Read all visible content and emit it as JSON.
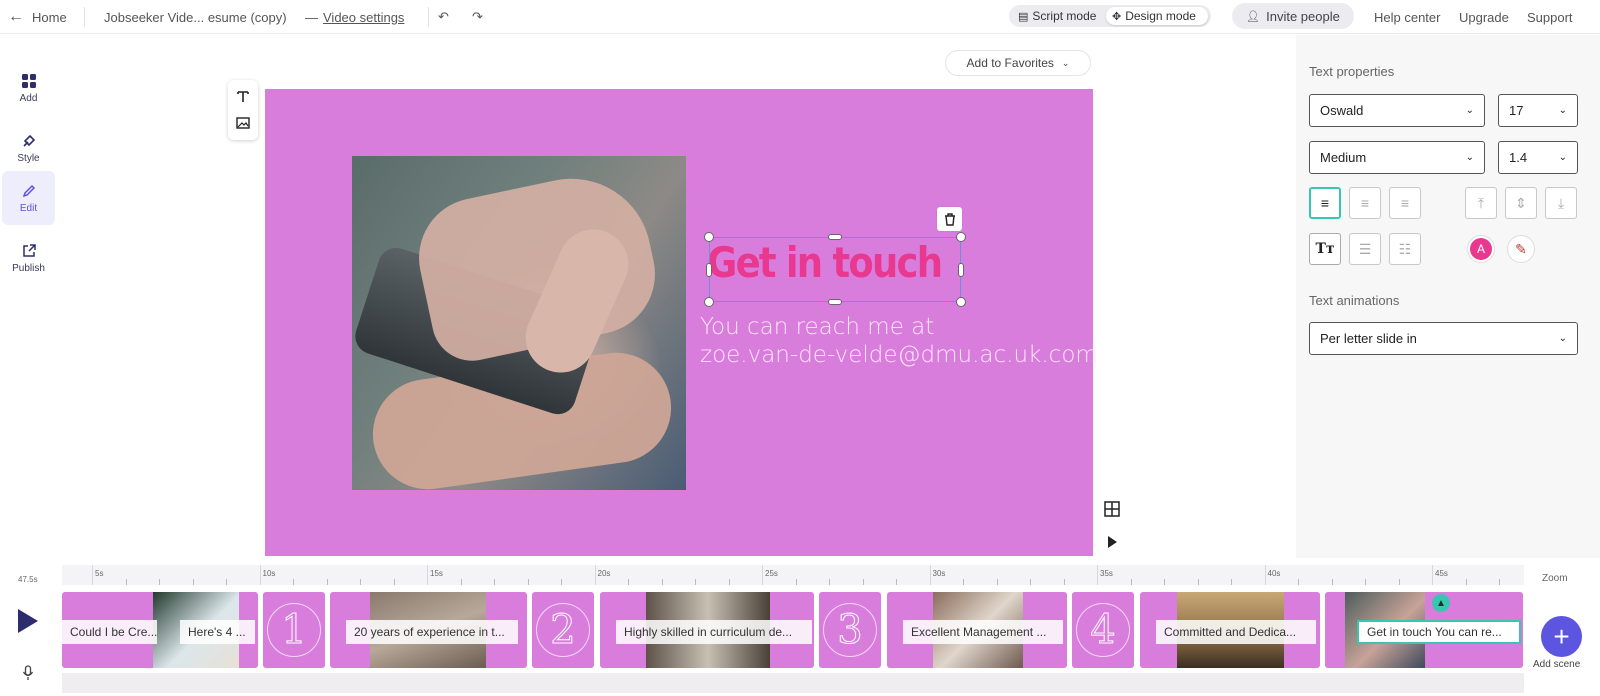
{
  "topbar": {
    "home_label": "Home",
    "project_title": "Jobseeker Vide... esume  (copy)",
    "dash": "—",
    "video_settings": "Video settings",
    "script_mode": "Script mode",
    "design_mode": "Design mode",
    "invite": "Invite people",
    "help": "Help center",
    "upgrade": "Upgrade",
    "support": "Support"
  },
  "rail": {
    "add": "Add",
    "style": "Style",
    "edit": "Edit",
    "publish": "Publish"
  },
  "canvas": {
    "favorites": "Add to Favorites",
    "headline": "Get in touch",
    "body_line1": "You can reach me at",
    "body_line2": "zoe.van-de-velde@dmu.ac.uk.com",
    "background_color": "#d97ddd",
    "headline_color": "#e8388f"
  },
  "panel": {
    "text_properties": "Text properties",
    "font": "Oswald",
    "size": "17",
    "weight": "Medium",
    "line_height": "1.4",
    "text_animations": "Text animations",
    "animation": "Per letter slide in",
    "color_swatch_letter": "A",
    "accent_color": "#39c6b0"
  },
  "timeline": {
    "start_time": "47.5s",
    "ticks": [
      "5s",
      "10s",
      "15s",
      "20s",
      "25s",
      "30s",
      "35s",
      "40s",
      "45s"
    ],
    "zoom": "Zoom",
    "add_scene": "Add scene",
    "clips": [
      {
        "label": "Could I be Cre...",
        "label2": "Here's 4 ..."
      },
      {
        "num": "1"
      },
      {
        "label": "20 years of experience in t..."
      },
      {
        "num": "2"
      },
      {
        "label": "Highly skilled in curriculum de..."
      },
      {
        "num": "3"
      },
      {
        "label": "Excellent Management ..."
      },
      {
        "num": "4"
      },
      {
        "label": "Committed and Dedica..."
      },
      {
        "label": "Get in touch You can re..."
      }
    ]
  }
}
